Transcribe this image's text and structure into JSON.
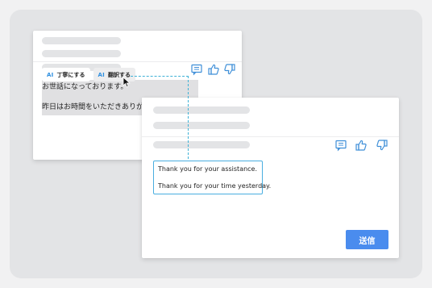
{
  "ai_toolbar": {
    "ai_badge": "AI",
    "polite_label": "丁寧にする",
    "translate_label": "翻訳する"
  },
  "source_message": {
    "line1": "お世話になっております。",
    "line2": "昨日はお時間をいただきありがとう"
  },
  "translation": {
    "line1": "Thank you for your assistance.",
    "line2": "Thank you for your time yesterday."
  },
  "send_button": {
    "label": "送信"
  },
  "colors": {
    "accent_blue": "#4a8cee",
    "ai_badge_blue": "#2e8fe0",
    "connector_dash": "#3fb2d6",
    "icon_blue": "#3f8fd8"
  },
  "icons": [
    "comment-icon",
    "thumbs-up-icon",
    "thumbs-down-icon",
    "pointer-cursor-icon"
  ]
}
